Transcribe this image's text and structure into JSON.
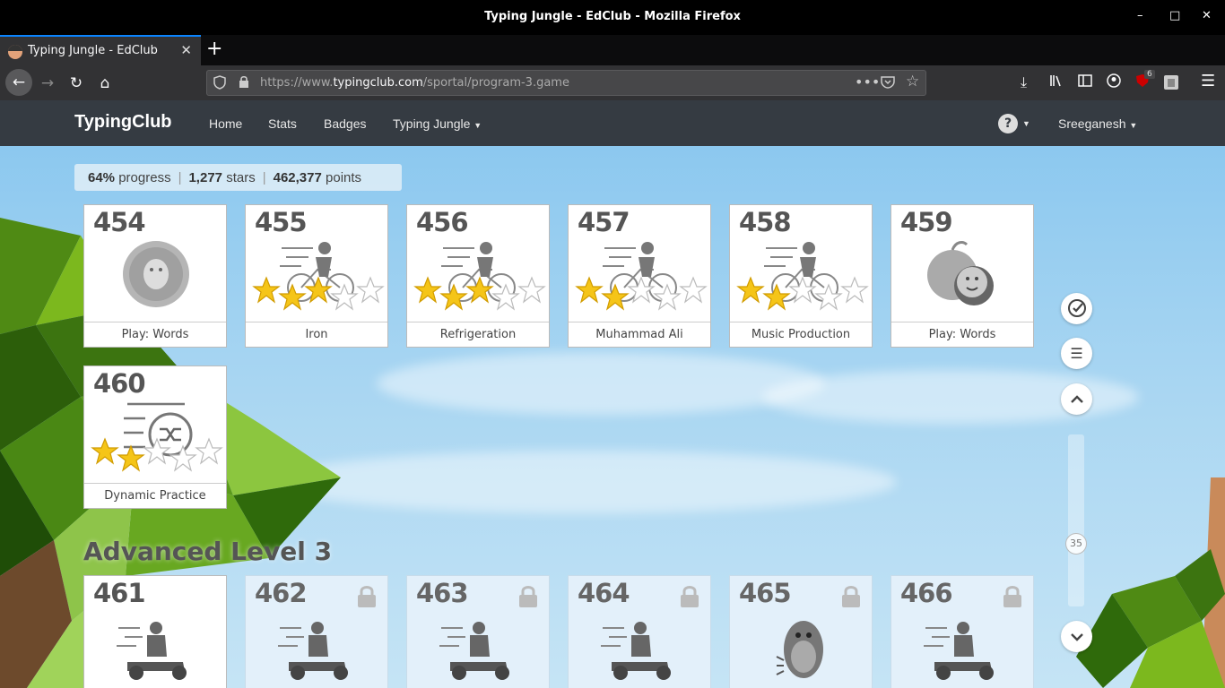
{
  "window": {
    "title": "Typing Jungle - EdClub - Mozilla Firefox"
  },
  "tab": {
    "label": "Typing Jungle - EdClub"
  },
  "urlbar": {
    "scheme_prefix": "https://www.",
    "host": "typingclub.com",
    "path": "/sportal/program-3.game"
  },
  "toolbar": {
    "badge_count": "6"
  },
  "site": {
    "brand": "TypingClub",
    "nav": [
      "Home",
      "Stats",
      "Badges",
      "Typing Jungle"
    ],
    "help": "?",
    "user": "Sreeganesh"
  },
  "progress": {
    "percent": "64%",
    "percent_label": "progress",
    "stars": "1,277",
    "stars_label": "stars",
    "points": "462,377",
    "points_label": "points"
  },
  "lessons": [
    {
      "num": "454",
      "caption": "Play: Words",
      "icon": "game-icon",
      "stars": null
    },
    {
      "num": "455",
      "caption": "Iron",
      "icon": "cyclist-icon",
      "stars": 3
    },
    {
      "num": "456",
      "caption": "Refrigeration",
      "icon": "cyclist-icon",
      "stars": 3
    },
    {
      "num": "457",
      "caption": "Muhammad Ali",
      "icon": "cyclist-icon",
      "stars": 2
    },
    {
      "num": "458",
      "caption": "Music Production",
      "icon": "cyclist-icon",
      "stars": 2
    },
    {
      "num": "459",
      "caption": "Play: Words",
      "icon": "apple-game-icon",
      "stars": null
    },
    {
      "num": "460",
      "caption": "Dynamic Practice",
      "icon": "shuffle-practice-icon",
      "stars": 2
    }
  ],
  "section": {
    "title": "Advanced Level 3"
  },
  "next_lessons": [
    {
      "num": "461",
      "icon": "scooter-icon",
      "locked": false
    },
    {
      "num": "462",
      "icon": "scooter-icon",
      "locked": true
    },
    {
      "num": "463",
      "icon": "scooter-icon",
      "locked": true
    },
    {
      "num": "464",
      "icon": "scooter-icon",
      "locked": true
    },
    {
      "num": "465",
      "icon": "monster-icon",
      "locked": true
    },
    {
      "num": "466",
      "icon": "scooter-icon",
      "locked": true
    }
  ],
  "scroll": {
    "position_label": "35"
  },
  "colors": {
    "header_bg": "#353b42",
    "star_fill": "#f5c518",
    "sky": "#a9d6f2"
  }
}
